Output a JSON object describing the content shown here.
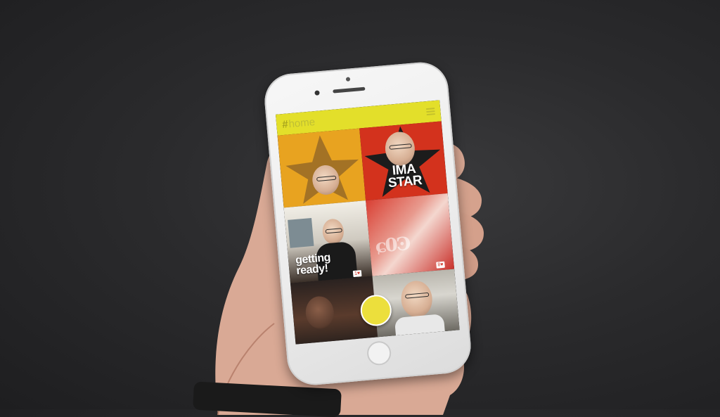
{
  "app": {
    "header": {
      "hash_symbol": "#",
      "title": "home",
      "menu_icon": "hamburger-icon"
    },
    "tiles": [
      {
        "id": "tile-star-orange",
        "caption": "",
        "colors": [
          "#e8a320",
          "#2a2a2a"
        ]
      },
      {
        "id": "tile-star-red",
        "caption_line1": "IMA",
        "caption_line2": "STAR",
        "colors": [
          "#d3321d",
          "#1a1a1a"
        ]
      },
      {
        "id": "tile-getting-ready",
        "caption_line1": "getting",
        "caption_line2": "ready!",
        "like_badge": "1♥"
      },
      {
        "id": "tile-red-print",
        "caption": "",
        "like_badge": "8♥"
      },
      {
        "id": "tile-dark-selfie",
        "caption": ""
      },
      {
        "id": "tile-man-glasses",
        "caption": ""
      }
    ],
    "record_button_color": "#ecdf3c"
  },
  "colors": {
    "header_bg": "#e3df2a",
    "background": "#2b2b2d",
    "phone_body": "#f2f2f2"
  }
}
